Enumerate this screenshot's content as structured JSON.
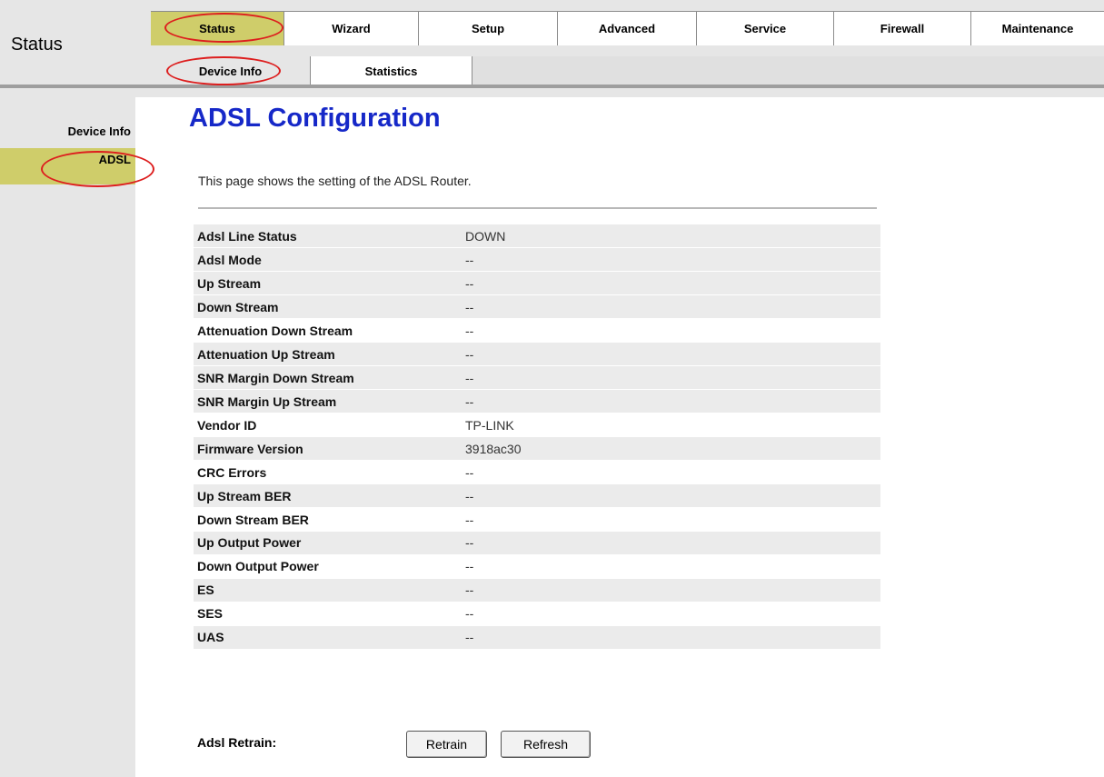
{
  "header": {
    "brand": "Status",
    "tabs": [
      {
        "label": "Status"
      },
      {
        "label": "Wizard"
      },
      {
        "label": "Setup"
      },
      {
        "label": "Advanced"
      },
      {
        "label": "Service"
      },
      {
        "label": "Firewall"
      },
      {
        "label": "Maintenance"
      }
    ],
    "subtabs": [
      {
        "label": "Device Info"
      },
      {
        "label": "Statistics"
      }
    ]
  },
  "sidebar": {
    "items": [
      {
        "label": "Device Info"
      },
      {
        "label": "ADSL"
      }
    ]
  },
  "main": {
    "title": "ADSL Configuration",
    "description": "This page shows the setting of the ADSL Router.",
    "rows": [
      {
        "label": "Adsl Line Status",
        "value": "DOWN"
      },
      {
        "label": "Adsl Mode",
        "value": "--"
      },
      {
        "label": "Up Stream",
        "value": "--"
      },
      {
        "label": "Down Stream",
        "value": "--"
      },
      {
        "label": "Attenuation Down Stream",
        "value": "--"
      },
      {
        "label": "Attenuation Up Stream",
        "value": "--"
      },
      {
        "label": "SNR Margin Down Stream",
        "value": "--"
      },
      {
        "label": "SNR Margin Up Stream",
        "value": "--"
      },
      {
        "label": "Vendor ID",
        "value": "TP-LINK"
      },
      {
        "label": "Firmware Version",
        "value": "3918ac30"
      },
      {
        "label": "CRC Errors",
        "value": "--"
      },
      {
        "label": "Up Stream BER",
        "value": "--"
      },
      {
        "label": "Down Stream BER",
        "value": "--"
      },
      {
        "label": "Up Output Power",
        "value": "--"
      },
      {
        "label": "Down Output Power",
        "value": "--"
      },
      {
        "label": "ES",
        "value": "--"
      },
      {
        "label": "SES",
        "value": "--"
      },
      {
        "label": "UAS",
        "value": "--"
      }
    ],
    "retrain_label": "Adsl Retrain:",
    "retrain_button": "Retrain",
    "refresh_button": "Refresh"
  },
  "colors": {
    "active_tab": "#cfcd6a",
    "title_blue": "#1628c8",
    "annotation_red": "#dd1e1e"
  }
}
